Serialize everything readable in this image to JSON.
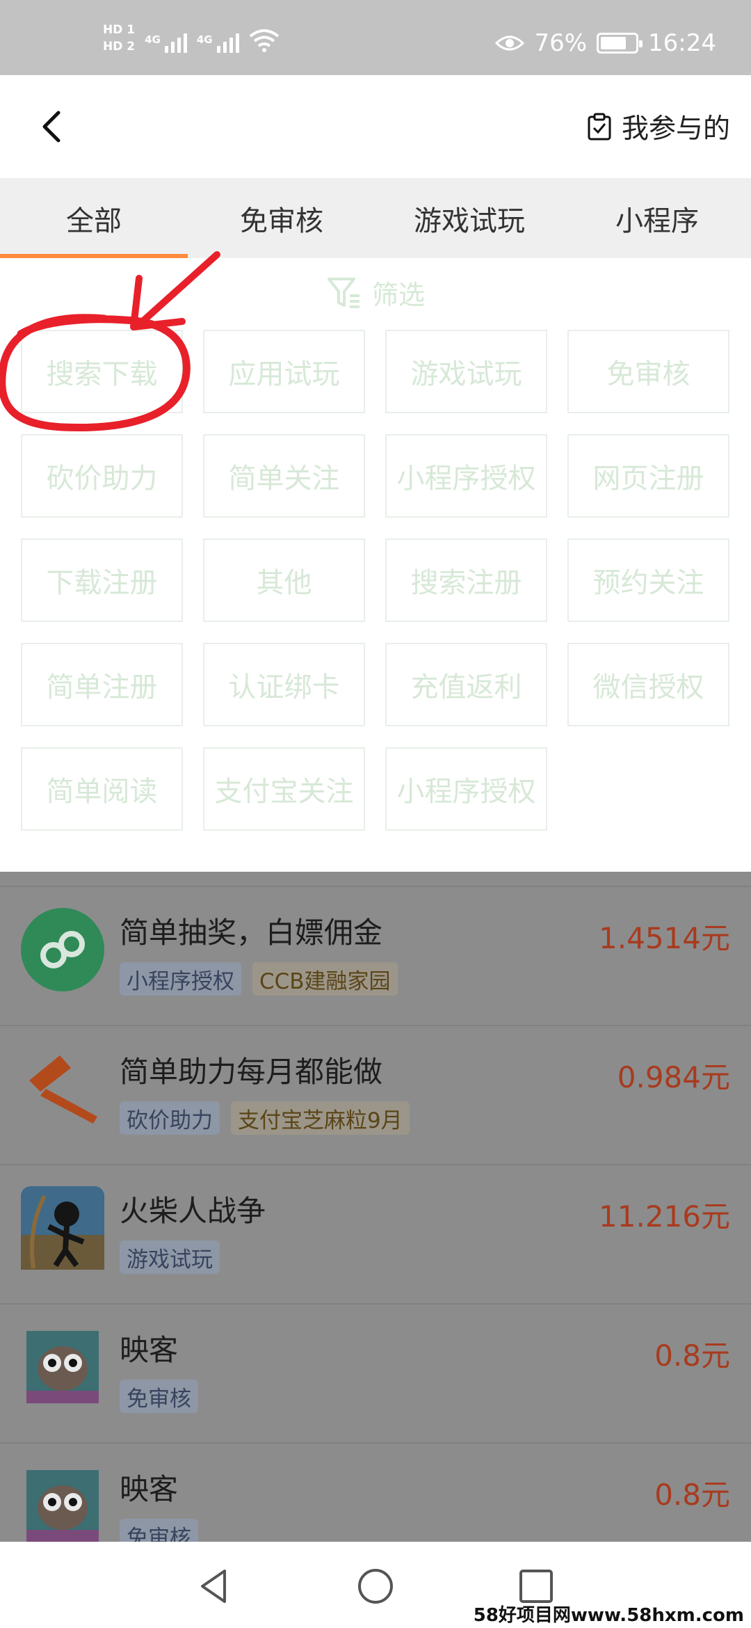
{
  "status_bar": {
    "hd1": "HD 1",
    "hd2": "HD 2",
    "net1": "4G",
    "net2": "4G",
    "battery_pct": "76%",
    "battery_level": 0.76,
    "time": "16:24"
  },
  "header": {
    "participated_label": "我参与的"
  },
  "tabs": [
    {
      "label": "全部",
      "active": true
    },
    {
      "label": "免审核",
      "active": false
    },
    {
      "label": "游戏试玩",
      "active": false
    },
    {
      "label": "小程序",
      "active": false
    }
  ],
  "filter": {
    "title": "筛选",
    "options": [
      "搜索下载",
      "应用试玩",
      "游戏试玩",
      "免审核",
      "砍价助力",
      "简单关注",
      "小程序授权",
      "网页注册",
      "下载注册",
      "其他",
      "搜索注册",
      "预约关注",
      "简单注册",
      "认证绑卡",
      "充值返利",
      "微信授权",
      "简单阅读",
      "支付宝关注",
      "小程序授权"
    ]
  },
  "tasks": [
    {
      "title": "简单抽奖，白嫖佣金",
      "price": "1.4514元",
      "tags": [
        {
          "text": "小程序授权",
          "style": "blue"
        },
        {
          "text": "CCB建融家园",
          "style": "gold"
        }
      ],
      "icon": "mini-program-icon"
    },
    {
      "title": "简单助力每月都能做",
      "price": "0.984元",
      "tags": [
        {
          "text": "砍价助力",
          "style": "blue"
        },
        {
          "text": "支付宝芝麻粒9月",
          "style": "gold"
        }
      ],
      "icon": "axe-icon"
    },
    {
      "title": "火柴人战争",
      "price": "11.216元",
      "tags": [
        {
          "text": "游戏试玩",
          "style": "blue"
        }
      ],
      "icon": "stickman-game-icon"
    },
    {
      "title": "映客",
      "price": "0.8元",
      "tags": [
        {
          "text": "免审核",
          "style": "blue"
        }
      ],
      "icon": "owl-app-icon"
    },
    {
      "title": "映客",
      "price": "0.8元",
      "tags": [
        {
          "text": "免审核",
          "style": "blue"
        }
      ],
      "icon": "owl-app-icon"
    }
  ],
  "watermark": "58好项目网www.58hxm.com",
  "colors": {
    "accent": "#ff8a3d",
    "price": "#a83b1f",
    "annotation": "#e8202a"
  }
}
